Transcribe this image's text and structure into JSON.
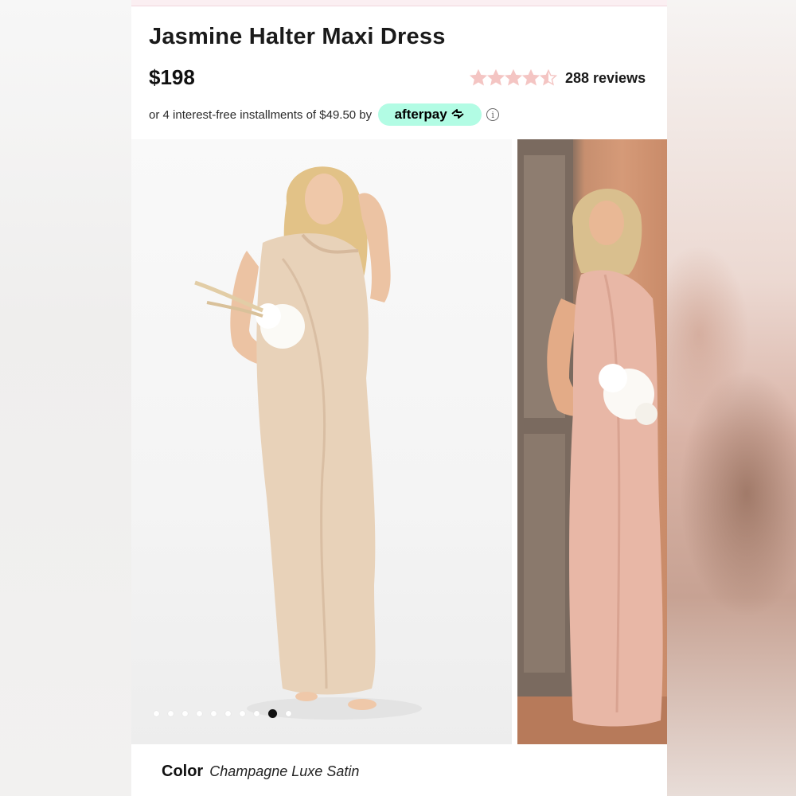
{
  "product": {
    "title": "Jasmine Halter Maxi Dress",
    "price": "$198",
    "rating": 4.5,
    "rating_max": 5,
    "reviews_label": "288 reviews",
    "star_color": "#f4c5c3"
  },
  "afterpay": {
    "text": "or 4 interest-free installments of $49.50 by",
    "brand": "afterpay",
    "brand_icon": "afterpay-arrows-icon",
    "badge_color": "#b2fce4",
    "info_icon": "info-icon"
  },
  "gallery": {
    "images": [
      {
        "description_name": "model-front-photo"
      },
      {
        "description_name": "model-doorway-photo"
      }
    ],
    "dot_count": 10,
    "active_dot": 8
  },
  "color": {
    "label": "Color",
    "value": "Champagne Luxe Satin"
  }
}
